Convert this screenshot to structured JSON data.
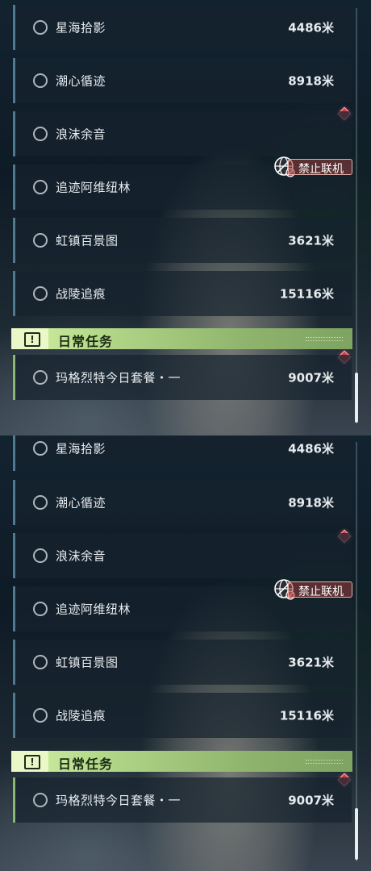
{
  "quests": [
    {
      "name": "星海拾影",
      "distance": "4486米"
    },
    {
      "name": "潮心循迹",
      "distance": "8918米"
    },
    {
      "name": "浪沫余音",
      "distance": ""
    },
    {
      "name": "追迹阿维纽林",
      "distance": ""
    },
    {
      "name": "虹镇百景图",
      "distance": "3621米"
    },
    {
      "name": "战陵追痕",
      "distance": "15116米"
    }
  ],
  "no_online_badge": "禁止联机",
  "daily": {
    "header_title": "日常任务",
    "exclaim": "!",
    "item": {
      "name": "玛格烈特今日套餐・一",
      "distance": "9007米"
    }
  },
  "colors": {
    "diamond_marker": "#c8404e",
    "daily_accent": "#b4d98a",
    "quest_border": "#4e7a92"
  },
  "icons": [
    "circle-icon",
    "globe-forbidden-icon",
    "diamond-marker-icon",
    "exclamation-icon"
  ]
}
